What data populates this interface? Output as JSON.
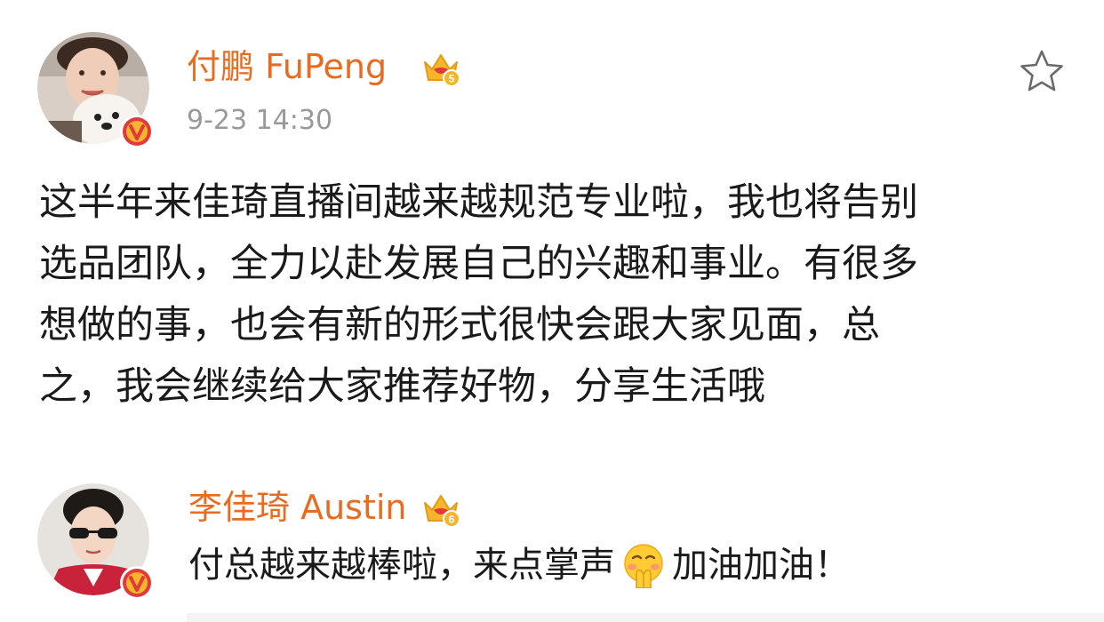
{
  "post": {
    "author": {
      "name": "付鹏 FuPeng",
      "avatar_icon": "avatar-photo-with-dog",
      "verified_icon": "verified-v-badge",
      "member_icon": "crown-level-5-icon",
      "member_level": "5"
    },
    "timestamp": "9-23 14:30",
    "favorite_icon": "star-outline-icon",
    "content_lines": [
      "这半年来佳琦直播间越来越规范专业啦，我也将告别",
      "选品团队，全力以赴发展自己的兴趣和事业。有很多",
      "想做的事，也会有新的形式很快会跟大家见面，总",
      "之，我会继续给大家推荐好物，分享生活哦"
    ]
  },
  "reply": {
    "author": {
      "name": "李佳琦 Austin",
      "avatar_icon": "avatar-photo-sunglasses",
      "verified_icon": "verified-v-badge",
      "member_icon": "crown-level-6-icon",
      "member_level": "6"
    },
    "text_before_emoji": "付总越来越棒啦，来点掌声",
    "emoji": "clapping-face-emoji",
    "text_after_emoji": "加油加油！"
  },
  "colors": {
    "username": "#e86b1f",
    "timestamp": "#999999",
    "body_text": "#1a1a1a",
    "badge_red": "#e4393c",
    "crown_gold": "#f6b62b"
  }
}
